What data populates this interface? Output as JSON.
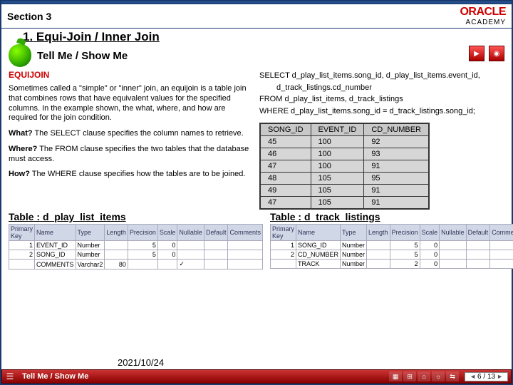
{
  "section": "Section 3",
  "logo_top": "ORACLE",
  "logo_bottom": "ACADEMY",
  "slide_title": "1. Equi-Join / Inner Join",
  "tellme": "Tell Me / Show Me",
  "equijoin_heading": "EQUIJOIN",
  "para1": "Sometimes called a \"simple\" or \"inner\" join, an equijoin is a table join that combines rows that have equivalent values for the specified columns. In the example shown, the what, where, and how are required for the join condition.",
  "what_b": "What?",
  "what_t": " The SELECT clause specifies the column names to retrieve.",
  "where_b": "Where?",
  "where_t": " The FROM clause specifies the two tables that the database must access.",
  "how_b": "How?",
  "how_t": " The WHERE clause specifies how the tables are to be joined.",
  "sql1": "SELECT d_play_list_items.song_id, d_play_list_items.event_id,",
  "sql2": "d_track_listings.cd_number",
  "sql3": "FROM d_play_list_items, d_track_listings",
  "sql4": "WHERE d_play_list_items.song_id = d_track_listings.song_id;",
  "result_headers": [
    "SONG_ID",
    "EVENT_ID",
    "CD_NUMBER"
  ],
  "result_rows": [
    [
      "45",
      "100",
      "92"
    ],
    [
      "46",
      "100",
      "93"
    ],
    [
      "47",
      "100",
      "91"
    ],
    [
      "48",
      "105",
      "95"
    ],
    [
      "49",
      "105",
      "91"
    ],
    [
      "47",
      "105",
      "91"
    ]
  ],
  "schema_left_title": "Table : d_play_list_items",
  "schema_right_title": "Table : d_track_listings",
  "schema_headers": [
    "Primary Key",
    "Name",
    "Type",
    "Length",
    "Precision",
    "Scale",
    "Nullable",
    "Default",
    "Comments"
  ],
  "schema_left_rows": [
    [
      "1",
      "EVENT_ID",
      "Number",
      "",
      "5",
      "0",
      "",
      "",
      ""
    ],
    [
      "2",
      "SONG_ID",
      "Number",
      "",
      "5",
      "0",
      "",
      "",
      ""
    ],
    [
      "",
      "COMMENTS",
      "Varchar2",
      "80",
      "",
      "",
      "✓",
      "",
      ""
    ]
  ],
  "schema_right_rows": [
    [
      "1",
      "SONG_ID",
      "Number",
      "",
      "5",
      "0",
      "",
      "",
      ""
    ],
    [
      "2",
      "CD_NUMBER",
      "Number",
      "",
      "5",
      "0",
      "",
      "",
      ""
    ],
    [
      "",
      "TRACK",
      "Number",
      "",
      "2",
      "0",
      "",
      "",
      ""
    ]
  ],
  "date": "2021/10/24",
  "footer_text": "Tell Me / Show Me",
  "page_now": "6",
  "page_total": "13"
}
